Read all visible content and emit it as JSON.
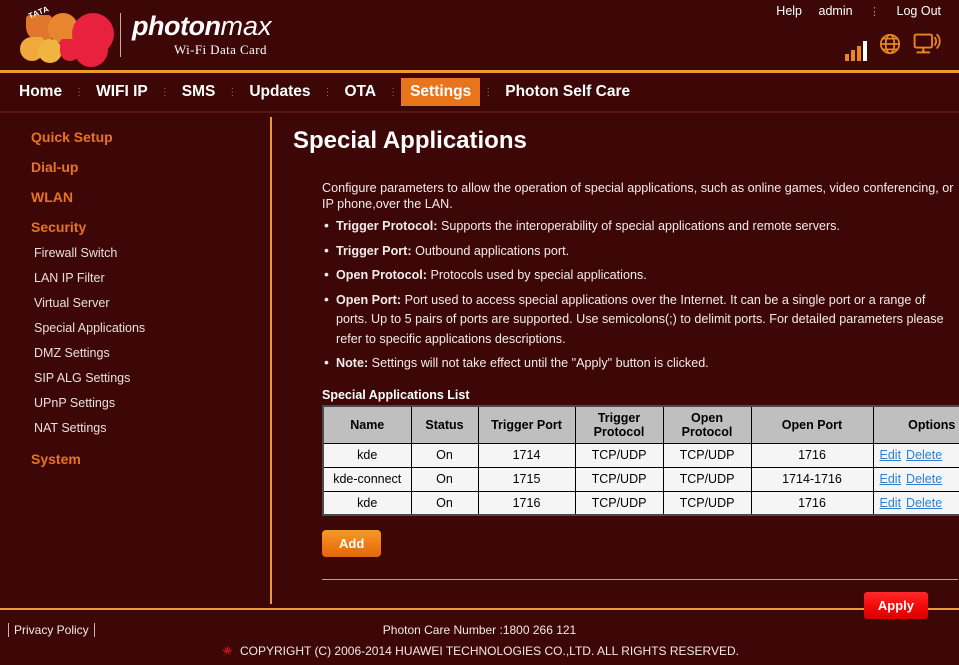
{
  "header": {
    "brand_main": "photon",
    "brand_suffix": "max",
    "brand_sub": "Wi-Fi Data Card",
    "tata_tag": "TATA",
    "links": {
      "help": "Help",
      "user": "admin",
      "separator": "⋮",
      "logout": "Log Out"
    },
    "icons": [
      "signal-bars-icon",
      "globe-icon",
      "monitor-wifi-icon"
    ]
  },
  "nav": {
    "separator": "⋮",
    "items": [
      {
        "label": "Home",
        "active": false
      },
      {
        "label": "WIFI IP",
        "active": false
      },
      {
        "label": "SMS",
        "active": false
      },
      {
        "label": "Updates",
        "active": false
      },
      {
        "label": "OTA",
        "active": false
      },
      {
        "label": "Settings",
        "active": true
      },
      {
        "label": "Photon Self Care",
        "active": false
      }
    ]
  },
  "sidebar": {
    "groups": [
      {
        "label": "Quick Setup"
      },
      {
        "label": "Dial-up"
      },
      {
        "label": "WLAN"
      },
      {
        "label": "Security"
      }
    ],
    "security_items": [
      {
        "label": "Firewall Switch"
      },
      {
        "label": "LAN IP Filter"
      },
      {
        "label": "Virtual Server"
      },
      {
        "label": "Special Applications"
      },
      {
        "label": "DMZ Settings"
      },
      {
        "label": "SIP ALG Settings"
      },
      {
        "label": "UPnP Settings"
      },
      {
        "label": "NAT Settings"
      }
    ],
    "system": {
      "label": "System"
    }
  },
  "main": {
    "title": "Special Applications",
    "intro": "Configure parameters to allow the operation of special applications, such as online games, video conferencing, or IP phone,over the LAN.",
    "bullets": [
      {
        "term": "Trigger Protocol:",
        "text": " Supports the interoperability of special applications and remote servers."
      },
      {
        "term": "Trigger Port:",
        "text": " Outbound applications port."
      },
      {
        "term": "Open Protocol:",
        "text": " Protocols used by special applications."
      },
      {
        "term": "Open Port:",
        "text": " Port used to access special applications over the Internet. It can be a single port or a range of ports. Up to 5 pairs of ports are supported. Use semicolons(;) to delimit ports. For detailed parameters please refer to specific applications descriptions."
      },
      {
        "term": "Note:",
        "text": " Settings will not take effect until the \"Apply\" button is clicked."
      }
    ],
    "list_label": "Special Applications List",
    "table": {
      "columns": [
        "Name",
        "Status",
        "Trigger Port",
        "Trigger Protocol",
        "Open Protocol",
        "Open Port",
        "Options"
      ],
      "rows": [
        {
          "name": "kde",
          "status": "On",
          "trigger_port": "1714",
          "trigger_protocol": "TCP/UDP",
          "open_protocol": "TCP/UDP",
          "open_port": "1716",
          "edit": "Edit",
          "delete": "Delete"
        },
        {
          "name": "kde-connect",
          "status": "On",
          "trigger_port": "1715",
          "trigger_protocol": "TCP/UDP",
          "open_protocol": "TCP/UDP",
          "open_port": "1714-1716",
          "edit": "Edit",
          "delete": "Delete"
        },
        {
          "name": "kde",
          "status": "On",
          "trigger_port": "1716",
          "trigger_protocol": "TCP/UDP",
          "open_protocol": "TCP/UDP",
          "open_port": "1716",
          "edit": "Edit",
          "delete": "Delete"
        }
      ]
    },
    "add_label": "Add",
    "apply_label": "Apply"
  },
  "footer": {
    "privacy": "Privacy Policy",
    "care": "Photon Care Number :1800 266 121",
    "copyright": "COPYRIGHT (C) 2006-2014 HUAWEI TECHNOLOGIES CO.,LTD. ALL RIGHTS RESERVED."
  },
  "colors": {
    "background": "#3d0707",
    "accent_orange": "#e8741c",
    "rule_orange": "#ee9a2e",
    "link_blue": "#2f7fd4",
    "apply_red": "#f40b0b",
    "table_header": "#bfbfbf",
    "table_cell": "#f5f5f5"
  }
}
